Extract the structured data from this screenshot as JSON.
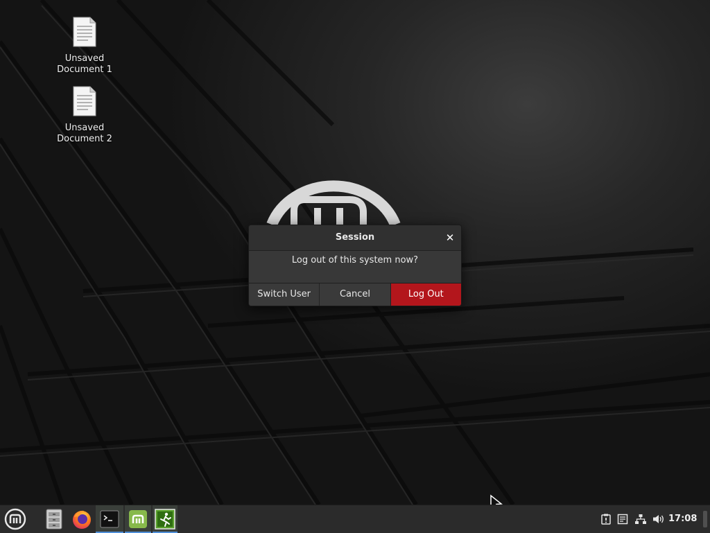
{
  "desktop": {
    "icons": [
      {
        "label": "Unsaved\nDocument 1",
        "icon": "text-document-icon"
      },
      {
        "label": "Unsaved\nDocument 2",
        "icon": "text-document-icon"
      }
    ],
    "wallpaper": "linux-mint-dark-tiles",
    "colors": {
      "background": "#141414",
      "logo": "#d8d8d8"
    }
  },
  "dialog": {
    "title": "Session",
    "close_glyph": "✕",
    "message": "Log out of this system now?",
    "buttons": {
      "switch_user": "Switch User",
      "cancel": "Cancel",
      "log_out": "Log Out"
    },
    "colors": {
      "danger": "#b3161c",
      "surface": "#2f2f2f"
    }
  },
  "panel": {
    "menu_icon": "mint-menu-icon",
    "launchers": [
      {
        "name": "file-manager-icon"
      },
      {
        "name": "firefox-icon"
      },
      {
        "name": "terminal-icon"
      },
      {
        "name": "mint-update-icon"
      },
      {
        "name": "logout-icon"
      }
    ],
    "tray": [
      "notifications-icon",
      "notes-icon",
      "network-icon",
      "volume-icon"
    ],
    "clock": "17:08",
    "colors": {
      "background": "#2b2b2b",
      "active_indicator": "#4f8fd9",
      "mint_green": "#87b94b"
    }
  }
}
